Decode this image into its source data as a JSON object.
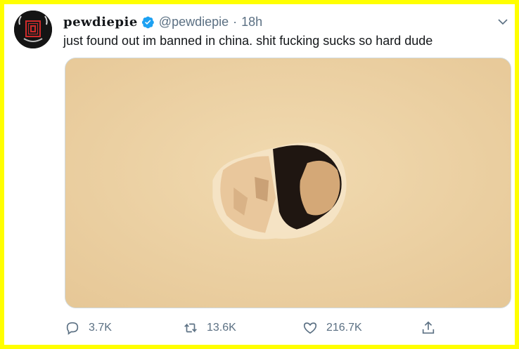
{
  "user": {
    "display_name": "pewdiepie",
    "handle": "@pewdiepie",
    "separator": "·",
    "time": "18h",
    "verified_color": "#1da1f2"
  },
  "tweet": {
    "text": "just found out im banned in china. shit fucking sucks so hard dude",
    "media_icon": "image-of-hole-in-wall"
  },
  "actions": {
    "reply_count": "3.7K",
    "retweet_count": "13.6K",
    "like_count": "216.7K"
  },
  "colors": {
    "border": "#ffff00",
    "text_secondary": "#5b7083",
    "text_primary": "#14171a"
  }
}
